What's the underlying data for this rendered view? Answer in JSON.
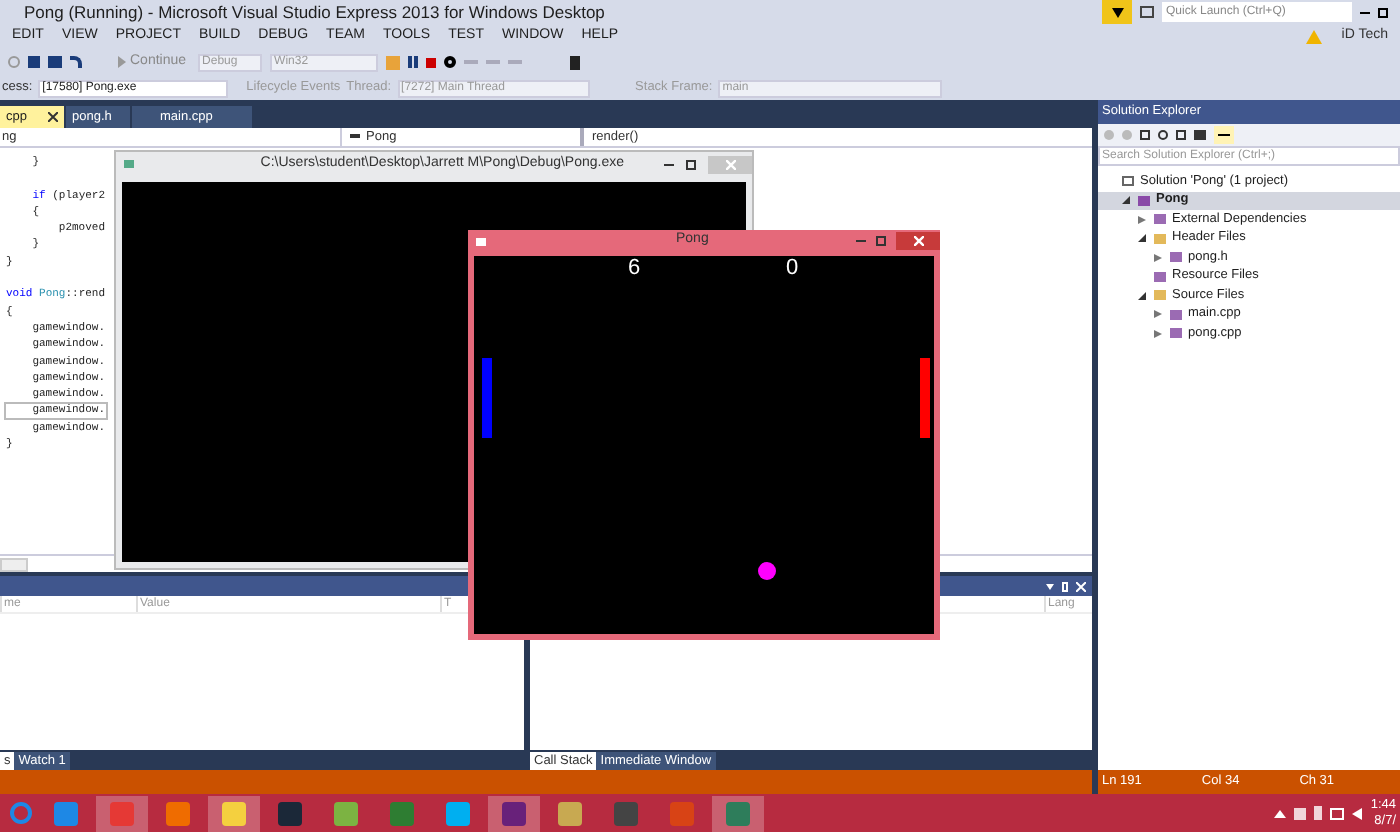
{
  "window": {
    "title": "Pong (Running) - Microsoft Visual Studio Express 2013 for Windows Desktop"
  },
  "quick_launch": {
    "placeholder": "Quick Launch (Ctrl+Q)"
  },
  "menu": [
    "EDIT",
    "VIEW",
    "PROJECT",
    "BUILD",
    "DEBUG",
    "TEAM",
    "TOOLS",
    "TEST",
    "WINDOW",
    "HELP"
  ],
  "account": "iD Tech",
  "debug_toolbar": {
    "continue": "Continue",
    "configuration": "Debug",
    "platform": "Win32"
  },
  "process_toolbar": {
    "process_label": "cess:",
    "process": "[17580] Pong.exe",
    "lifecycle": "Lifecycle Events",
    "thread_label": "Thread:",
    "thread": "[7272] Main Thread",
    "stack_frame_label": "Stack Frame:",
    "stack_frame": "main"
  },
  "editor_tabs": [
    {
      "label": "cpp",
      "selected": true
    },
    {
      "label": "pong.h",
      "selected": false
    },
    {
      "label": "main.cpp",
      "selected": false
    }
  ],
  "navigation_bar": {
    "scope": "ng",
    "class": "Pong",
    "member": "render()"
  },
  "code_lines": [
    {
      "current": false,
      "tokens": [
        {
          "kind": "plain",
          "text": "    }"
        }
      ]
    },
    {
      "kind": "blank"
    },
    {
      "current": false,
      "tokens": [
        {
          "kind": "keyword",
          "text": "    if"
        },
        {
          "kind": "plain",
          "text": " (player2"
        }
      ]
    },
    {
      "current": false,
      "tokens": [
        {
          "kind": "plain",
          "text": "    {"
        }
      ]
    },
    {
      "current": false,
      "tokens": [
        {
          "kind": "plain",
          "text": "        p2moved"
        }
      ]
    },
    {
      "current": false,
      "tokens": [
        {
          "kind": "plain",
          "text": "    }"
        }
      ]
    },
    {
      "current": false,
      "tokens": [
        {
          "kind": "plain",
          "text": "}"
        }
      ]
    },
    {
      "kind": "blank"
    },
    {
      "current": false,
      "tokens": [
        {
          "kind": "keyword",
          "text": "void "
        },
        {
          "kind": "type",
          "text": "Pong"
        },
        {
          "kind": "plain",
          "text": "::rend"
        }
      ]
    },
    {
      "current": false,
      "tokens": [
        {
          "kind": "plain",
          "text": "{"
        }
      ]
    },
    {
      "current": false,
      "tokens": [
        {
          "kind": "plain",
          "text": "    gamewindow."
        }
      ]
    },
    {
      "current": false,
      "tokens": [
        {
          "kind": "plain",
          "text": "    gamewindow."
        }
      ]
    },
    {
      "current": false,
      "tokens": [
        {
          "kind": "plain",
          "text": "    gamewindow."
        }
      ]
    },
    {
      "current": false,
      "tokens": [
        {
          "kind": "plain",
          "text": "    gamewindow."
        }
      ]
    },
    {
      "current": false,
      "tokens": [
        {
          "kind": "plain",
          "text": "    gamewindow."
        }
      ]
    },
    {
      "current": true,
      "tokens": [
        {
          "kind": "plain",
          "text": "    gamewindow."
        }
      ]
    },
    {
      "current": false,
      "tokens": [
        {
          "kind": "plain",
          "text": "    gamewindow."
        }
      ]
    },
    {
      "current": false,
      "tokens": [
        {
          "kind": "plain",
          "text": "}"
        }
      ]
    }
  ],
  "solution_explorer": {
    "title": "Solution Explorer",
    "search": {
      "placeholder": "Search Solution Explorer (Ctrl+;)"
    },
    "tree": [
      {
        "label": "Solution 'Pong' (1 project)",
        "selected": false,
        "children": [
          {
            "label": "Pong",
            "selected": true,
            "expanded": true,
            "children": [
              {
                "label": "External Dependencies",
                "selected": false,
                "expanded": false
              },
              {
                "label": "Header Files",
                "selected": false,
                "expanded": true,
                "children": [
                  {
                    "label": "pong.h",
                    "selected": false,
                    "expanded": false
                  }
                ]
              },
              {
                "label": "Resource Files",
                "selected": false
              },
              {
                "label": "Source Files",
                "selected": false,
                "expanded": true,
                "children": [
                  {
                    "label": "main.cpp",
                    "selected": false,
                    "expanded": false
                  },
                  {
                    "label": "pong.cpp",
                    "selected": false,
                    "expanded": false
                  }
                ]
              }
            ]
          }
        ]
      }
    ]
  },
  "watch_panel": {
    "columns": [
      "me",
      "Value",
      "T"
    ],
    "tabs": [
      {
        "label": "s",
        "selected": true
      },
      {
        "label": "Watch 1",
        "selected": false
      }
    ]
  },
  "call_stack_panel": {
    "columns": [
      "Lang"
    ],
    "tabs": [
      {
        "label": "Call Stack",
        "selected": true
      },
      {
        "label": "Immediate Window",
        "selected": false
      }
    ]
  },
  "status_bar": [
    "Ln 191",
    "Col 34",
    "Ch 31"
  ],
  "console_window": {
    "title": "C:\\Users\\student\\Desktop\\Jarrett M\\Pong\\Debug\\Pong.exe"
  },
  "pong_window": {
    "title": "Pong",
    "players": [
      {
        "score": "6",
        "color": "#0000ff"
      },
      {
        "score": "0",
        "color": "#ff0000"
      }
    ]
  },
  "taskbar": {
    "apps": [
      {
        "color": "#1e88e5",
        "selected": false
      },
      {
        "color": "#e53935",
        "selected": true
      },
      {
        "color": "#ef6c00",
        "selected": false
      },
      {
        "color": "#f4d03f",
        "selected": true
      },
      {
        "color": "#1b2838",
        "selected": false
      },
      {
        "color": "#7cb342",
        "selected": false
      },
      {
        "color": "#2e7d32",
        "selected": false
      },
      {
        "color": "#00aff0",
        "selected": false
      },
      {
        "color": "#68217a",
        "selected": true
      },
      {
        "color": "#c8a951",
        "selected": false
      },
      {
        "color": "#444444",
        "selected": false
      },
      {
        "color": "#d84315",
        "selected": false
      },
      {
        "color": "#2e7d5b",
        "selected": true
      }
    ],
    "time": "1:44",
    "date": "8/7/"
  }
}
